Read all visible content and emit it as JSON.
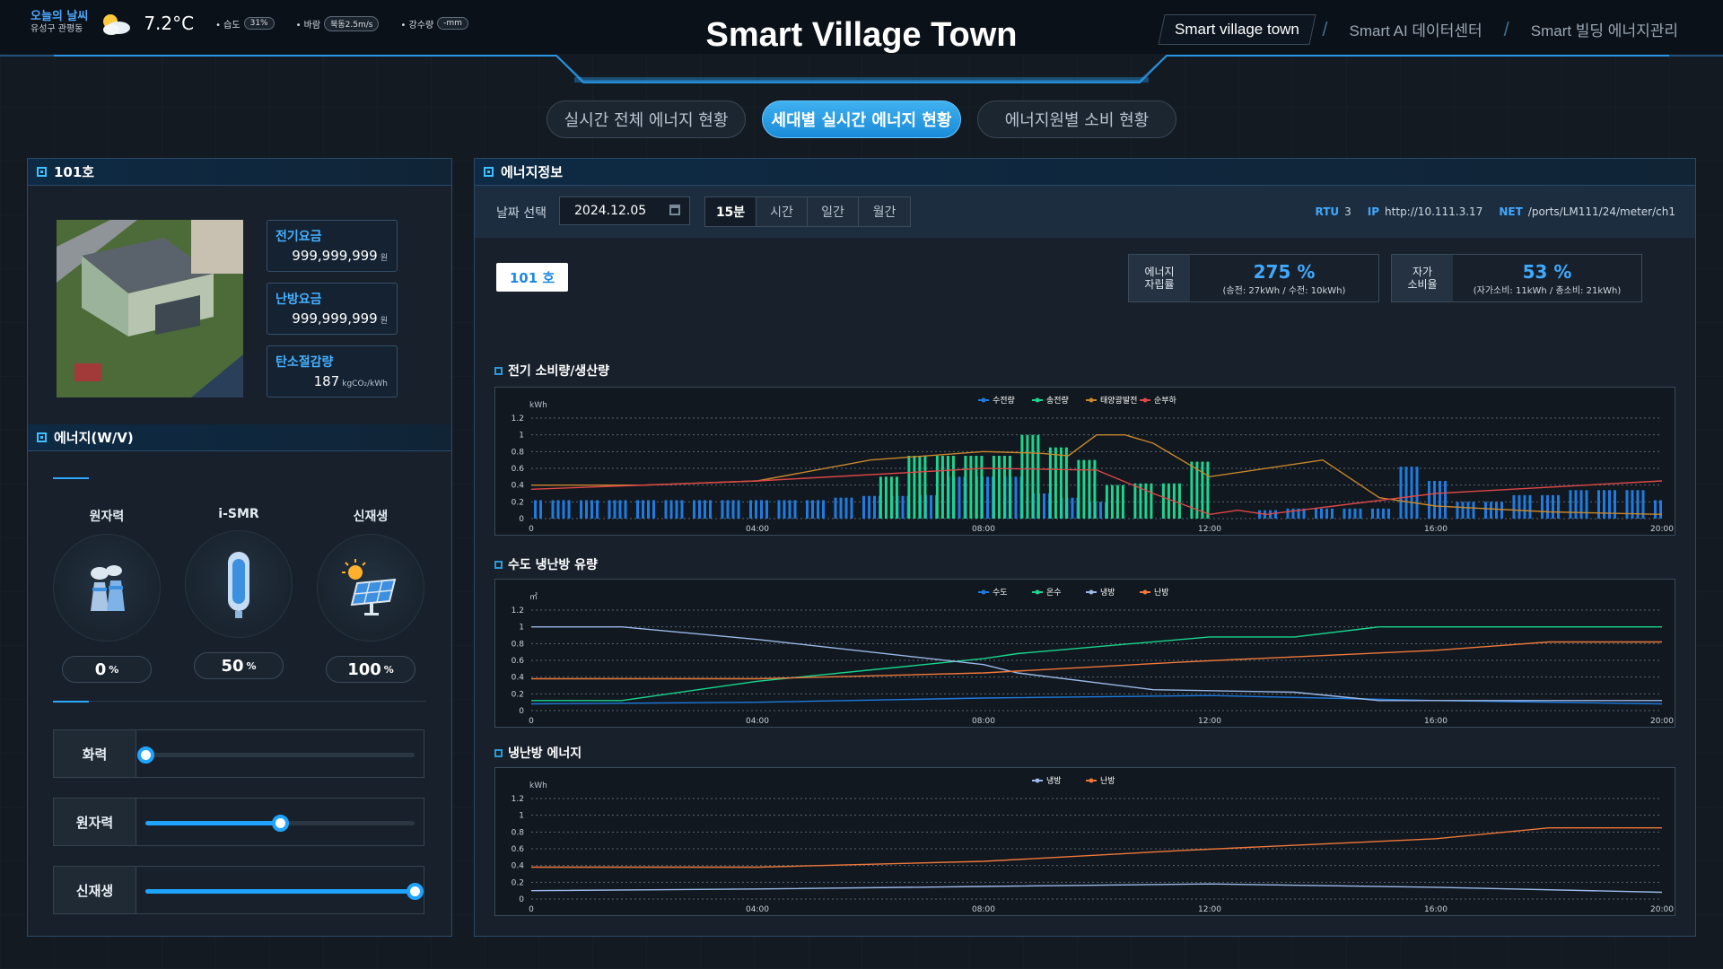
{
  "header": {
    "weather_label": "오늘의 날씨",
    "location": "유성구 관평동",
    "temperature": "7.2°C",
    "humidity_label": "• 습도",
    "humidity_value": "31%",
    "wind_label": "• 바람",
    "wind_value": "북동2.5m/s",
    "rain_label": "• 강수량",
    "rain_value": "-mm",
    "title": "Smart Village Town",
    "nav": [
      "Smart village town",
      "Smart AI 데이터센터",
      "Smart 빌딩 에너지관리"
    ]
  },
  "tabs": [
    "실시간 전체 에너지 현황",
    "세대별 실시간 에너지 현황",
    "에너지원별 소비 현황"
  ],
  "left": {
    "unit_title": "101호",
    "fees": [
      {
        "label": "전기요금",
        "value": "999,999,999",
        "unit": "원"
      },
      {
        "label": "난방요금",
        "value": "999,999,999",
        "unit": "원"
      },
      {
        "label": "탄소절감량",
        "value": "187",
        "unit": "kgCO₂/kWh"
      }
    ],
    "energy_title": "에너지(W/V)",
    "sources": [
      {
        "name": "원자력",
        "pct": "0",
        "unit": "%"
      },
      {
        "name": "i-SMR",
        "pct": "50",
        "unit": "%"
      },
      {
        "name": "신재생",
        "pct": "100",
        "unit": "%"
      }
    ],
    "sliders": [
      {
        "label": "화력",
        "level": 0
      },
      {
        "label": "원자력",
        "level": 0.5
      },
      {
        "label": "신재생",
        "level": 1.0
      }
    ]
  },
  "right": {
    "title": "에너지정보",
    "date_label": "날짜 선택",
    "date_value": "2024.12.05",
    "periods": [
      "15분",
      "시간",
      "일간",
      "월간"
    ],
    "rtu_label": "RTU",
    "rtu_value": "3",
    "ip_label": "IP",
    "ip_value": "http://10.111.3.17",
    "net_label": "NET",
    "net_value": "/ports/LM111/24/meter/ch1",
    "unit_button": "101 호",
    "kpis": [
      {
        "label_line1": "에너지",
        "label_line2": "자립률",
        "value": "275 %",
        "sub": "(송전: 27kWh / 수전: 10kWh)"
      },
      {
        "label_line1": "자가",
        "label_line2": "소비율",
        "value": "53 %",
        "sub": "(자가소비: 11kWh / 총소비: 21kWh)"
      }
    ]
  },
  "chart_data": [
    {
      "type": "bar",
      "title": "전기 소비량/생산량",
      "ylabel": "kWh",
      "ylim": [
        0,
        1.2
      ],
      "yticks": [
        "0",
        "0.2",
        "0.4",
        "0.6",
        "0.8",
        "1",
        "1.2"
      ],
      "xticks": [
        "0",
        "04:00",
        "08:00",
        "12:00",
        "16:00",
        "20:00"
      ],
      "x_range": [
        0,
        20
      ],
      "grid": true,
      "legend_position": "top",
      "series": [
        {
          "name": "수전량",
          "color": "#1e7be0",
          "kind": "bar",
          "x": [
            0,
            0.5,
            1,
            1.5,
            2,
            2.5,
            3,
            3.5,
            4,
            4.5,
            5,
            5.5,
            6,
            6.5,
            7,
            7.5,
            8,
            8.5,
            9,
            9.5,
            10,
            10.5,
            11,
            11.5,
            12,
            12.5,
            13,
            13.5,
            14,
            14.5,
            15,
            15.5,
            16,
            16.5,
            17,
            17.5,
            18,
            18.5,
            19,
            19.5,
            20
          ],
          "values": [
            0.22,
            0.22,
            0.22,
            0.22,
            0.22,
            0.22,
            0.22,
            0.22,
            0.22,
            0.22,
            0.22,
            0.25,
            0.27,
            0.27,
            0.28,
            0.5,
            0.5,
            0.5,
            0.3,
            0.25,
            0.2,
            0,
            0,
            0,
            0,
            0,
            0.1,
            0.12,
            0.12,
            0.12,
            0.12,
            0.62,
            0.45,
            0.2,
            0.2,
            0.28,
            0.28,
            0.34,
            0.34,
            0.34,
            0.22
          ]
        },
        {
          "name": "송전량",
          "color": "#19d68e",
          "kind": "bar",
          "x": [
            6.3,
            6.8,
            7.3,
            7.8,
            8.3,
            8.8,
            9.3,
            9.8,
            10.3,
            10.8,
            11.3,
            11.8
          ],
          "values": [
            0.5,
            0.75,
            0.75,
            0.75,
            0.75,
            1.0,
            0.85,
            0.7,
            0.4,
            0.42,
            0.42,
            0.68
          ]
        },
        {
          "name": "태양광발전",
          "color": "#c9872b",
          "kind": "line",
          "x": [
            0,
            2,
            4,
            6,
            8,
            9,
            9.5,
            10,
            10.5,
            11,
            12,
            14,
            15,
            16,
            18,
            20
          ],
          "values": [
            0.4,
            0.4,
            0.45,
            0.7,
            0.8,
            0.78,
            0.75,
            1.0,
            1.0,
            0.9,
            0.5,
            0.7,
            0.25,
            0.15,
            0.08,
            0.05
          ]
        },
        {
          "name": "순부하",
          "color": "#e04848",
          "kind": "line",
          "x": [
            0,
            4,
            8,
            10,
            11,
            12,
            12.5,
            13,
            16,
            20
          ],
          "values": [
            0.35,
            0.45,
            0.6,
            0.58,
            0.3,
            0.05,
            0.1,
            0.05,
            0.3,
            0.45
          ]
        }
      ]
    },
    {
      "type": "line",
      "title": "수도 냉난방 유량",
      "ylabel": "㎥",
      "ylim": [
        0,
        1.2
      ],
      "yticks": [
        "0",
        "0.2",
        "0.4",
        "0.6",
        "0.8",
        "1",
        "1.2"
      ],
      "xticks": [
        "0",
        "04:00",
        "08:00",
        "12:00",
        "16:00",
        "20:00"
      ],
      "x_range": [
        0,
        20
      ],
      "grid": true,
      "legend_position": "top",
      "series": [
        {
          "name": "수도",
          "color": "#1e7be0",
          "x": [
            0,
            4,
            8,
            12,
            16,
            20
          ],
          "values": [
            0.08,
            0.1,
            0.15,
            0.18,
            0.12,
            0.08
          ]
        },
        {
          "name": "온수",
          "color": "#19d68e",
          "x": [
            0,
            1.6,
            4,
            8,
            8.6,
            12,
            13.5,
            15,
            20
          ],
          "values": [
            0.12,
            0.12,
            0.35,
            0.62,
            0.68,
            0.88,
            0.88,
            1.0,
            1.0
          ]
        },
        {
          "name": "냉방",
          "color": "#9bb8e8",
          "x": [
            0,
            1.6,
            4,
            8,
            8.6,
            11,
            13.5,
            15,
            20
          ],
          "values": [
            1.0,
            1.0,
            0.85,
            0.55,
            0.45,
            0.25,
            0.22,
            0.12,
            0.12
          ]
        },
        {
          "name": "난방",
          "color": "#f0783a",
          "x": [
            0,
            4,
            8,
            11.5,
            16,
            18,
            20
          ],
          "values": [
            0.38,
            0.38,
            0.45,
            0.58,
            0.72,
            0.82,
            0.82
          ]
        }
      ]
    },
    {
      "type": "line",
      "title": "냉난방 에너지",
      "ylabel": "kWh",
      "ylim": [
        0,
        1.2
      ],
      "yticks": [
        "0",
        "0.2",
        "0.4",
        "0.6",
        "0.8",
        "1",
        "1.2"
      ],
      "xticks": [
        "0",
        "04:00",
        "08:00",
        "12:00",
        "16:00",
        "20:00"
      ],
      "x_range": [
        0,
        20
      ],
      "grid": true,
      "legend_position": "top",
      "series": [
        {
          "name": "냉방",
          "color": "#9bb8e8",
          "x": [
            0,
            4,
            8,
            12,
            16,
            20
          ],
          "values": [
            0.1,
            0.12,
            0.15,
            0.18,
            0.14,
            0.08
          ]
        },
        {
          "name": "난방",
          "color": "#f0783a",
          "x": [
            0,
            4,
            8,
            11.5,
            16,
            18,
            20
          ],
          "values": [
            0.38,
            0.38,
            0.45,
            0.58,
            0.72,
            0.85,
            0.85
          ]
        }
      ]
    }
  ]
}
